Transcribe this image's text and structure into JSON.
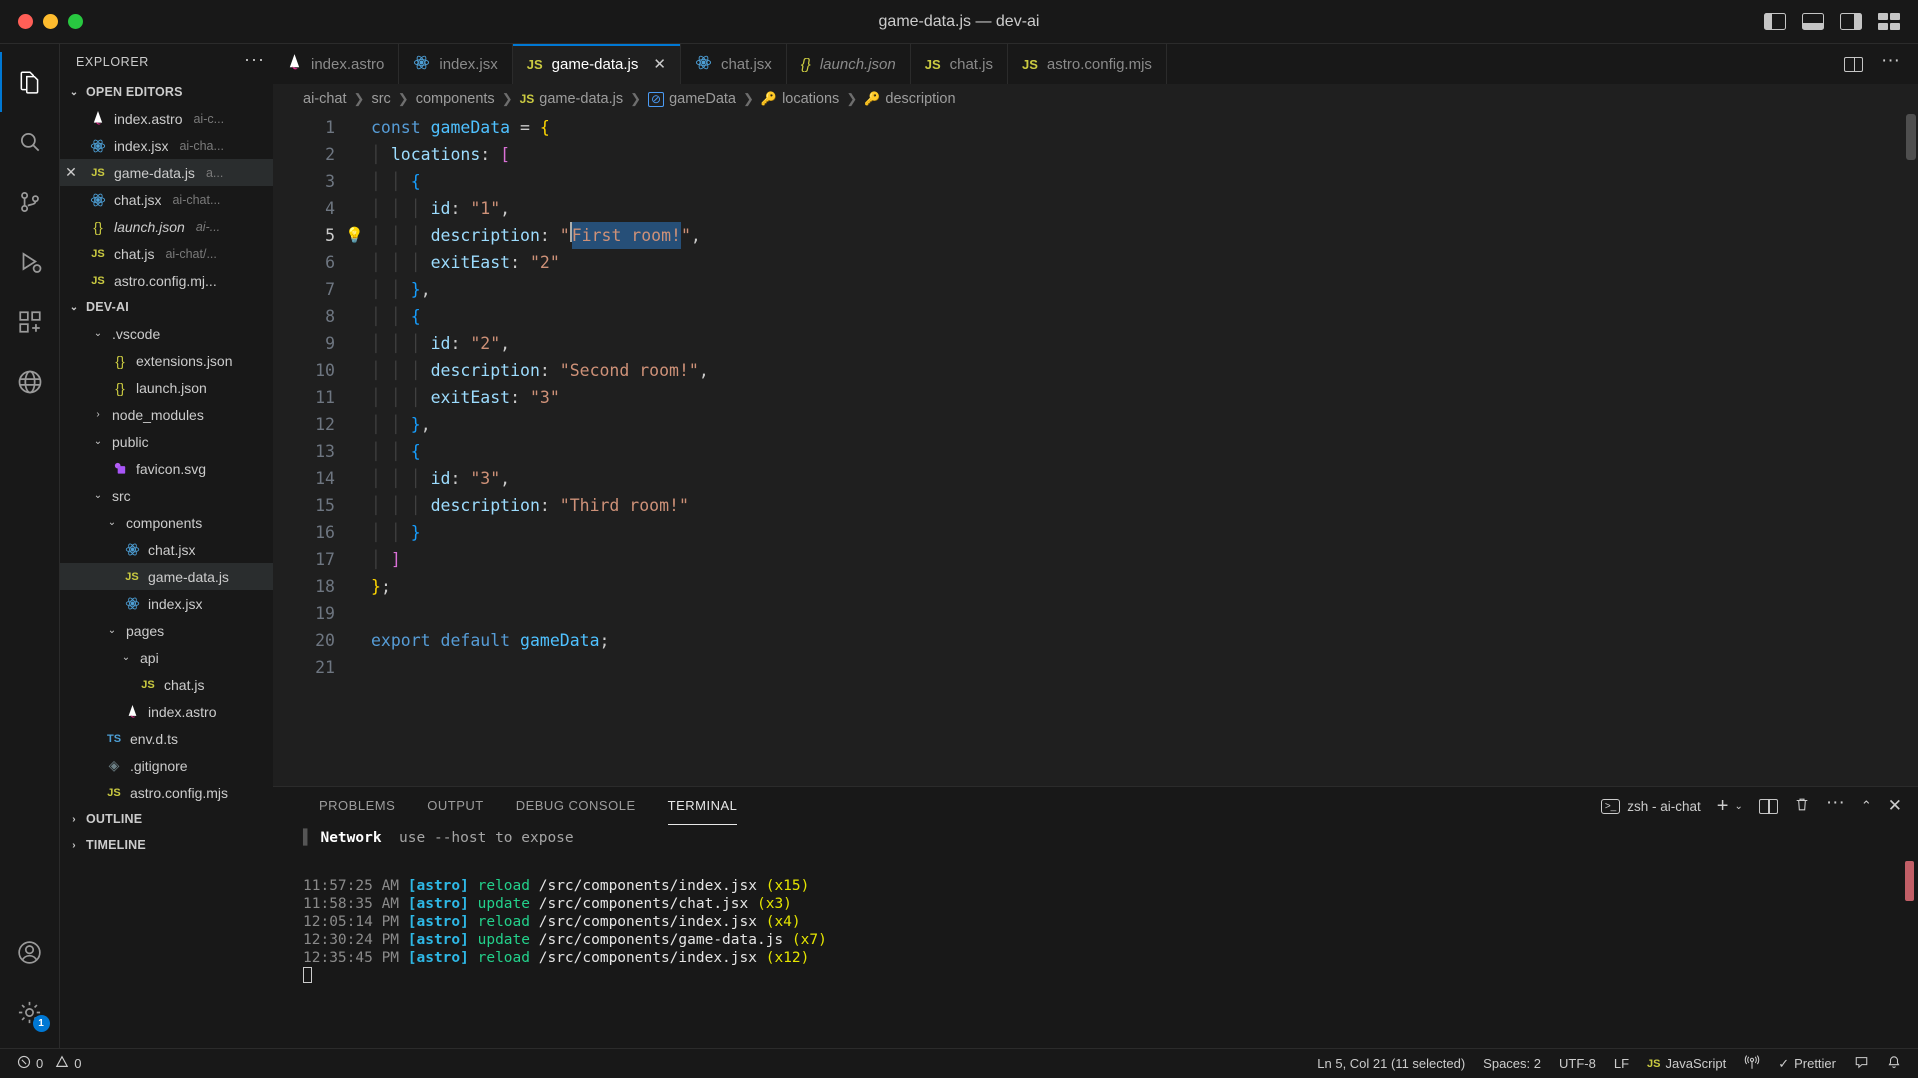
{
  "window": {
    "title": "game-data.js — dev-ai"
  },
  "titlebar": {
    "buttons": [
      "close",
      "minimize",
      "maximize"
    ],
    "actions": [
      "toggle-primary-sidebar",
      "toggle-panel",
      "toggle-secondary-sidebar",
      "customize-layout"
    ]
  },
  "activitybar": {
    "items": [
      {
        "name": "explorer",
        "icon": "files-icon",
        "active": true
      },
      {
        "name": "search",
        "icon": "search-icon",
        "active": false
      },
      {
        "name": "source-control",
        "icon": "source-control-icon",
        "active": false
      },
      {
        "name": "run-and-debug",
        "icon": "debug-icon",
        "active": false
      },
      {
        "name": "extensions",
        "icon": "extensions-icon",
        "active": false
      },
      {
        "name": "remote-explorer",
        "icon": "remote-icon",
        "active": false
      }
    ],
    "bottom": [
      {
        "name": "accounts",
        "icon": "account-icon",
        "badge": ""
      },
      {
        "name": "manage",
        "icon": "gear-icon",
        "badge": "1"
      }
    ]
  },
  "sidebar": {
    "header": "EXPLORER",
    "more_label": "···",
    "sections": [
      {
        "title": "OPEN EDITORS",
        "expanded": true
      },
      {
        "title": "DEV-AI",
        "expanded": true
      },
      {
        "title": "OUTLINE",
        "expanded": false
      },
      {
        "title": "TIMELINE",
        "expanded": false
      }
    ],
    "open_editors": [
      {
        "name": "index.astro",
        "suffix": "ai-c...",
        "icon": "astro-icon",
        "selected": false,
        "dirty": false,
        "italic": false
      },
      {
        "name": "index.jsx",
        "suffix": "ai-cha...",
        "icon": "react-icon",
        "selected": false,
        "dirty": false,
        "italic": false
      },
      {
        "name": "game-data.js",
        "suffix": "a...",
        "icon": "js-icon",
        "selected": true,
        "dirty": false,
        "italic": false
      },
      {
        "name": "chat.jsx",
        "suffix": "ai-chat...",
        "icon": "react-icon",
        "selected": false,
        "dirty": false,
        "italic": false
      },
      {
        "name": "launch.json",
        "suffix": "ai-...",
        "icon": "json-icon",
        "selected": false,
        "dirty": false,
        "italic": true
      },
      {
        "name": "chat.js",
        "suffix": "ai-chat/...",
        "icon": "js-icon",
        "selected": false,
        "dirty": false,
        "italic": false
      },
      {
        "name": "astro.config.mj...",
        "suffix": "",
        "icon": "js-icon",
        "selected": false,
        "dirty": false,
        "italic": false
      }
    ],
    "tree": [
      {
        "label": ".vscode",
        "type": "folder",
        "depth": 1,
        "expanded": true
      },
      {
        "label": "extensions.json",
        "type": "json",
        "depth": 2
      },
      {
        "label": "launch.json",
        "type": "json",
        "depth": 2
      },
      {
        "label": "node_modules",
        "type": "folder",
        "depth": 1,
        "expanded": false
      },
      {
        "label": "public",
        "type": "folder",
        "depth": 1,
        "expanded": true
      },
      {
        "label": "favicon.svg",
        "type": "svg",
        "depth": 2
      },
      {
        "label": "src",
        "type": "folder",
        "depth": 1,
        "expanded": true
      },
      {
        "label": "components",
        "type": "folder",
        "depth": 2,
        "expanded": true
      },
      {
        "label": "chat.jsx",
        "type": "react",
        "depth": 3
      },
      {
        "label": "game-data.js",
        "type": "js",
        "depth": 3,
        "selected": true
      },
      {
        "label": "index.jsx",
        "type": "react",
        "depth": 3
      },
      {
        "label": "pages",
        "type": "folder",
        "depth": 2,
        "expanded": true
      },
      {
        "label": "api",
        "type": "folder",
        "depth": 3,
        "expanded": true
      },
      {
        "label": "chat.js",
        "type": "js",
        "depth": 4
      },
      {
        "label": "index.astro",
        "type": "astro",
        "depth": 3
      },
      {
        "label": "env.d.ts",
        "type": "ts",
        "depth": 2
      },
      {
        "label": ".gitignore",
        "type": "git",
        "depth": 2
      },
      {
        "label": "astro.config.mjs",
        "type": "js",
        "depth": 2
      }
    ]
  },
  "tabs": [
    {
      "label": "index.astro",
      "icon": "astro-icon",
      "active": false,
      "italic": false,
      "closable": false
    },
    {
      "label": "index.jsx",
      "icon": "react-icon",
      "active": false,
      "italic": false,
      "closable": false
    },
    {
      "label": "game-data.js",
      "icon": "js-icon",
      "active": true,
      "italic": false,
      "closable": true
    },
    {
      "label": "chat.jsx",
      "icon": "react-icon",
      "active": false,
      "italic": false,
      "closable": false
    },
    {
      "label": "launch.json",
      "icon": "json-icon",
      "active": false,
      "italic": true,
      "closable": false
    },
    {
      "label": "chat.js",
      "icon": "js-icon",
      "active": false,
      "italic": false,
      "closable": false
    },
    {
      "label": "astro.config.mjs",
      "icon": "js-icon",
      "active": false,
      "italic": false,
      "closable": false
    }
  ],
  "breadcrumb": [
    {
      "label": "ai-chat",
      "icon": ""
    },
    {
      "label": "src",
      "icon": ""
    },
    {
      "label": "components",
      "icon": ""
    },
    {
      "label": "game-data.js",
      "icon": "js-icon"
    },
    {
      "label": "gameData",
      "icon": "symbol-object-icon"
    },
    {
      "label": "locations",
      "icon": "symbol-property-icon"
    },
    {
      "label": "description",
      "icon": "symbol-property-icon"
    }
  ],
  "editor": {
    "line_numbers": [
      "1",
      "2",
      "3",
      "4",
      "5",
      "6",
      "7",
      "8",
      "9",
      "10",
      "11",
      "12",
      "13",
      "14",
      "15",
      "16",
      "17",
      "18",
      "19",
      "20",
      "21"
    ],
    "current_line": 5,
    "lightbulb_line": 5,
    "selected_text": "First room!",
    "lines": [
      "const gameData = {",
      "  locations: [",
      "    {",
      "      id: \"1\",",
      "      description: \"First room!\",",
      "      exitEast: \"2\"",
      "    },",
      "    {",
      "      id: \"2\",",
      "      description: \"Second room!\",",
      "      exitEast: \"3\"",
      "    },",
      "    {",
      "      id: \"3\",",
      "      description: \"Third room!\"",
      "    }",
      "  ]",
      "};",
      "",
      "export default gameData;",
      ""
    ]
  },
  "panel": {
    "tabs": [
      {
        "label": "PROBLEMS",
        "active": false
      },
      {
        "label": "OUTPUT",
        "active": false
      },
      {
        "label": "DEBUG CONSOLE",
        "active": false
      },
      {
        "label": "TERMINAL",
        "active": true
      }
    ],
    "terminal_name": "zsh - ai-chat",
    "actions": [
      "new-terminal",
      "split-terminal",
      "kill-terminal",
      "more-actions",
      "maximize-panel",
      "close-panel"
    ],
    "network_label": "Network",
    "network_hint": "use --host to expose",
    "lines": [
      {
        "time": "11:57:25 AM",
        "tag": "[astro]",
        "action": "reload",
        "path": "/src/components/index.jsx",
        "count": "(x15)"
      },
      {
        "time": "11:58:35 AM",
        "tag": "[astro]",
        "action": "update",
        "path": "/src/components/chat.jsx",
        "count": "(x3)"
      },
      {
        "time": "12:05:14 PM",
        "tag": "[astro]",
        "action": "reload",
        "path": "/src/components/index.jsx",
        "count": "(x4)"
      },
      {
        "time": "12:30:24 PM",
        "tag": "[astro]",
        "action": "update",
        "path": "/src/components/game-data.js",
        "count": "(x7)"
      },
      {
        "time": "12:35:45 PM",
        "tag": "[astro]",
        "action": "reload",
        "path": "/src/components/index.jsx",
        "count": "(x12)"
      }
    ]
  },
  "statusbar": {
    "errors": "0",
    "warnings": "0",
    "cursor": "Ln 5, Col 21 (11 selected)",
    "indent": "Spaces: 2",
    "encoding": "UTF-8",
    "eol": "LF",
    "language": "JavaScript",
    "prettier": "Prettier",
    "prettier_icon": "check-icon",
    "bell_icon": "bell-icon",
    "radio_icon": "radio-tower-icon",
    "feedback_icon": "feedback-icon"
  },
  "colors": {
    "accent": "#0078d4",
    "bg": "#1f1f1f",
    "chrome": "#181818",
    "selection": "#264f78",
    "js_yellow": "#cbcb41",
    "string": "#ce9178"
  }
}
